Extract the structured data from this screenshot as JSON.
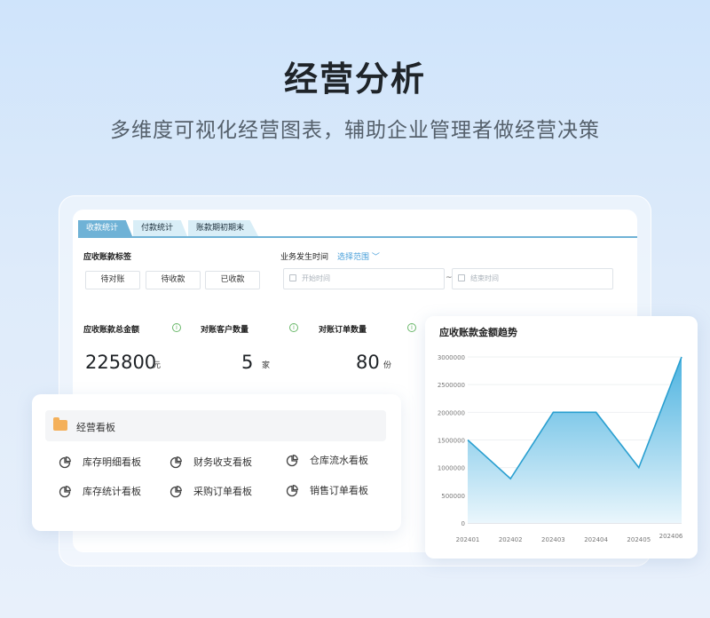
{
  "hero": {
    "title": "经营分析",
    "subtitle": "多维度可视化经营图表，辅助企业管理者做经营决策"
  },
  "tabs": [
    {
      "label": "收款统计",
      "active": true
    },
    {
      "label": "付款统计",
      "active": false
    },
    {
      "label": "账款期初期末",
      "active": false
    }
  ],
  "filters": {
    "tag_label": "应收账款标签",
    "tags": [
      "待对账",
      "待收款",
      "已收款"
    ],
    "time_label": "业务发生时间",
    "range_link": "选择范围 ﹀",
    "start_placeholder": "开始时间",
    "end_placeholder": "结束时间",
    "separator": "~"
  },
  "stats": [
    {
      "label": "应收账款总金额",
      "value": "225800",
      "unit": "元"
    },
    {
      "label": "对账客户数量",
      "value": "5",
      "unit": "家"
    },
    {
      "label": "对账订单数量",
      "value": "80",
      "unit": "份"
    }
  ],
  "board": {
    "title": "经营看板",
    "items": [
      "库存明细看板",
      "财务收支看板",
      "仓库流水看板",
      "库存统计看板",
      "采购订单看板",
      "销售订单看板"
    ]
  },
  "colors": {
    "accent": "#6fb2d6",
    "line": "#2a9fd0",
    "fill_top": "#4db3e0",
    "fill_bottom": "#eaf6fc"
  },
  "chart_data": {
    "type": "area",
    "title": "应收账款金额趋势",
    "categories": [
      "202401",
      "202402",
      "202403",
      "202404",
      "202405",
      "202406"
    ],
    "values": [
      1500000,
      800000,
      2000000,
      2000000,
      1000000,
      3000000
    ],
    "yticks": [
      "0",
      "500000",
      "1000000",
      "1500000",
      "2000000",
      "2500000",
      "3000000"
    ],
    "ylim": [
      0,
      3000000
    ],
    "grid": true
  }
}
